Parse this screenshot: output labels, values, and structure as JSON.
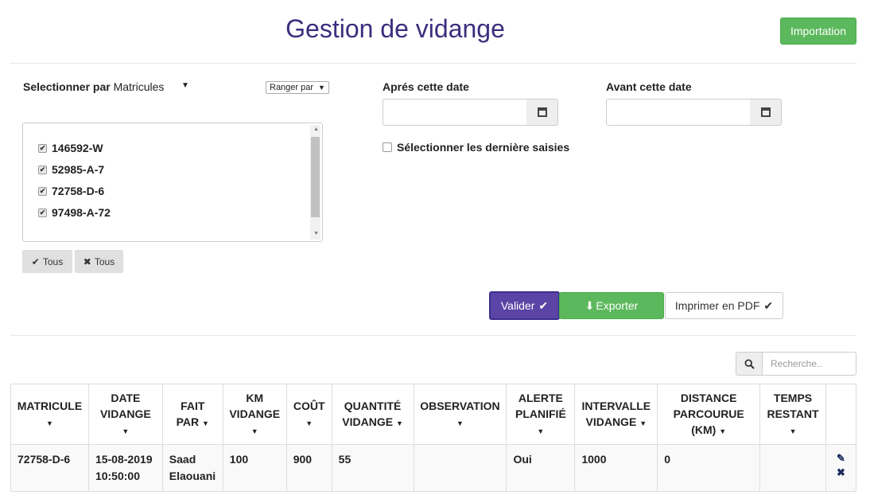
{
  "header": {
    "title": "Gestion de vidange",
    "import_label": "Importation"
  },
  "filters": {
    "select_by_bold": "Selectionner par",
    "select_by_value": "Matricules",
    "sort_label": "Ranger par",
    "matricules": [
      "146592-W",
      "52985-A-7",
      "72758-D-6",
      "97498-A-72"
    ],
    "all_check_label": "Tous",
    "all_uncheck_label": "Tous",
    "after_date_label": "Aprés cette date",
    "before_date_label": "Avant cette date",
    "last_entries_label": "Sélectionner les dernière saisies"
  },
  "actions": {
    "valider_label": "Valider",
    "exporter_label": "Exporter",
    "pdf_label": "Imprimer en PDF"
  },
  "search": {
    "placeholder": "Recherche.."
  },
  "table": {
    "columns": [
      [
        "MATRICULE"
      ],
      [
        "DATE",
        "VIDANGE"
      ],
      [
        "FAIT",
        "PAR"
      ],
      [
        "KM",
        "VIDANGE"
      ],
      [
        "COÛT"
      ],
      [
        "QUANTITÉ",
        "VIDANGE"
      ],
      [
        "OBSERVATION"
      ],
      [
        "ALERTE",
        "PLANIFIÉ"
      ],
      [
        "INTERVALLE",
        "VIDANGE"
      ],
      [
        "DISTANCE",
        "PARCOURUE",
        "(KM)"
      ],
      [
        "TEMPS",
        "RESTANT"
      ]
    ],
    "rows": [
      {
        "matricule": "72758-D-6",
        "date_1": "15-08-2019",
        "date_2": "10:50:00",
        "fait_par_1": "Saad",
        "fait_par_2": "Elaouani",
        "km": "100",
        "cout": "900",
        "quantite": "55",
        "observation": "",
        "alerte": "Oui",
        "intervalle": "1000",
        "distance": "0",
        "temps": ""
      }
    ]
  },
  "colors": {
    "brand": "#3b2e7e",
    "primary": "#5b44a5",
    "success": "#5cb85c"
  }
}
